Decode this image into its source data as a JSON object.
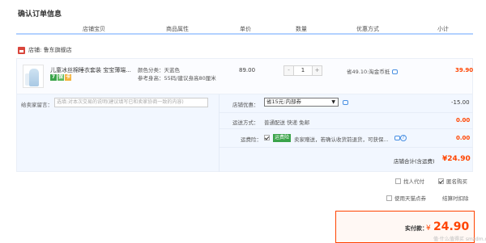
{
  "page_title": "确认订单信息",
  "columns": {
    "shop_item": "店铺宝贝",
    "item_props": "商品属性",
    "unit_price": "单价",
    "quantity": "数量",
    "discount": "优惠方式",
    "subtotal": "小计"
  },
  "shop": {
    "label": "店铺: 鲁东旗舰店"
  },
  "item": {
    "name": "儿童冰丝棉睡衣套装 宝宝薄端...",
    "badges": [
      "7",
      "保",
      "卡"
    ],
    "color_label": "颜色分类：天蓝色",
    "size_label": "参考身高：55码/建议身高80厘米",
    "unit_price": "89.00",
    "quantity": "1",
    "qty_minus": "-",
    "qty_plus": "+",
    "discount": "省49.10:淘金币抵",
    "subtotal": "39.90"
  },
  "note": {
    "label": "给卖家留言：",
    "placeholder": "选填:对本次交易的说明(建议填写已和卖家协商一致的内容)"
  },
  "coupon": {
    "label": "店铺优惠：",
    "selected": "省15元:内部券",
    "amount": "-15.00"
  },
  "shipping": {
    "label": "运送方式：",
    "value": "普通配送 快递 免邮",
    "amount": "0.00"
  },
  "insurance": {
    "label": "运费险：",
    "tag": "运费险",
    "desc": "卖家赠送，若确认收货前退货，可获保...",
    "amount": "0.00",
    "help": "?"
  },
  "shop_total": {
    "label": "店铺合计(含运费)",
    "value": "¥24.90"
  },
  "options": {
    "proxy_pay": "找人代付",
    "anonymous": "匿名购买",
    "tmall_points": "使用天猫点券",
    "points_deduct": "结算时扣除"
  },
  "payment": {
    "label": "实付款：",
    "currency": "¥",
    "amount": "24.90"
  },
  "watermark": "值·什么值得买 smzdm.com"
}
